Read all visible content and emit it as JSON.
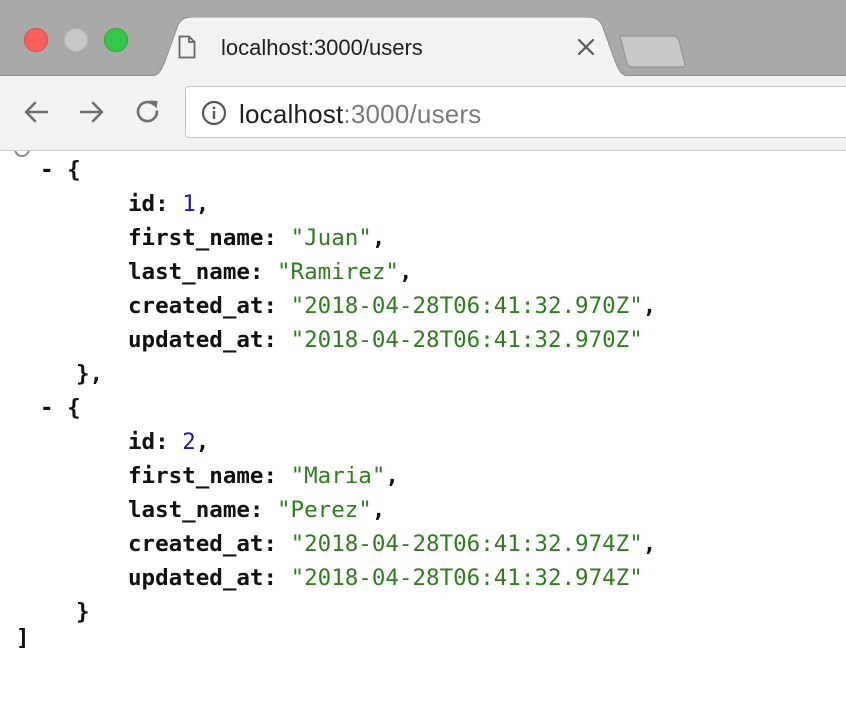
{
  "tab": {
    "title": "localhost:3000/users"
  },
  "address_bar": {
    "host": "localhost",
    "rest": ":3000/users"
  },
  "colors": {
    "number": "#1a1aa6",
    "string": "#2e7d1e"
  },
  "icons": {
    "close_window": "close-circle",
    "minimize_window": "minimize-circle",
    "maximize_window": "maximize-circle",
    "tab_page": "page-icon",
    "tab_close": "close-icon",
    "back": "arrow-left-icon",
    "forward": "arrow-right-icon",
    "reload": "reload-icon",
    "site_info": "info-icon"
  },
  "json_view": {
    "lines": [
      {
        "bullet": "- {",
        "key": "",
        "value": "",
        "value_type": "",
        "tail": ""
      },
      {
        "bullet": "",
        "key": "id",
        "value": "1",
        "value_type": "num",
        "tail": ","
      },
      {
        "bullet": "",
        "key": "first_name",
        "value": "\"Juan\"",
        "value_type": "str",
        "tail": ","
      },
      {
        "bullet": "",
        "key": "last_name",
        "value": "\"Ramirez\"",
        "value_type": "str",
        "tail": ","
      },
      {
        "bullet": "",
        "key": "created_at",
        "value": "\"2018-04-28T06:41:32.970Z\"",
        "value_type": "str",
        "tail": ","
      },
      {
        "bullet": "",
        "key": "updated_at",
        "value": "\"2018-04-28T06:41:32.970Z\"",
        "value_type": "str",
        "tail": ""
      },
      {
        "bullet": "},",
        "key": "",
        "value": "",
        "value_type": "",
        "tail": ""
      },
      {
        "bullet": "- {",
        "key": "",
        "value": "",
        "value_type": "",
        "tail": ""
      },
      {
        "bullet": "",
        "key": "id",
        "value": "2",
        "value_type": "num",
        "tail": ","
      },
      {
        "bullet": "",
        "key": "first_name",
        "value": "\"Maria\"",
        "value_type": "str",
        "tail": ","
      },
      {
        "bullet": "",
        "key": "last_name",
        "value": "\"Perez\"",
        "value_type": "str",
        "tail": ","
      },
      {
        "bullet": "",
        "key": "created_at",
        "value": "\"2018-04-28T06:41:32.974Z\"",
        "value_type": "str",
        "tail": ","
      },
      {
        "bullet": "",
        "key": "updated_at",
        "value": "\"2018-04-28T06:41:32.974Z\"",
        "value_type": "str",
        "tail": ""
      },
      {
        "bullet": "}",
        "key": "",
        "value": "",
        "value_type": "",
        "tail": ""
      },
      {
        "bullet": "]",
        "key": "",
        "value": "",
        "value_type": "",
        "tail": ""
      }
    ]
  }
}
